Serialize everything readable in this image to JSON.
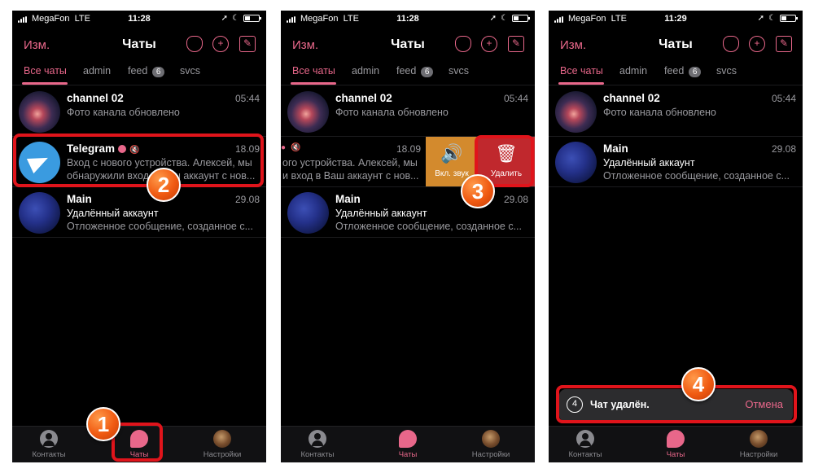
{
  "screens": [
    {
      "status": {
        "carrier": "MegaFon",
        "network": "LTE",
        "time": "11:28"
      },
      "header": {
        "edit": "Изм.",
        "title": "Чаты"
      },
      "tabs": [
        {
          "label": "Все чаты",
          "active": true
        },
        {
          "label": "admin"
        },
        {
          "label": "feed",
          "badge": "6"
        },
        {
          "label": "svcs"
        }
      ],
      "chats": [
        {
          "name": "channel 02",
          "time": "05:44",
          "line1": "Фото канала обновлено",
          "line2": ""
        },
        {
          "name": "Telegram",
          "time": "18.09",
          "line1": "Вход с нового устройства. Алексей, мы",
          "line2": "обнаружили вход в Ваш аккаунт с нов..."
        },
        {
          "name": "Main",
          "time": "29.08",
          "line1": "Удалённый аккаунт",
          "line2": "Отложенное сообщение, созданное с..."
        }
      ],
      "tabbar": [
        {
          "label": "Контакты",
          "icon": "person-icon"
        },
        {
          "label": "Чаты",
          "icon": "chats-icon",
          "active": true
        },
        {
          "label": "Настройки",
          "icon": "settings-avatar-icon"
        }
      ]
    },
    {
      "status": {
        "carrier": "MegaFon",
        "network": "LTE",
        "time": "11:28"
      },
      "header": {
        "edit": "Изм.",
        "title": "Чаты"
      },
      "tabs": [
        {
          "label": "Все чаты",
          "active": true
        },
        {
          "label": "admin"
        },
        {
          "label": "feed",
          "badge": "6"
        },
        {
          "label": "svcs"
        }
      ],
      "chats": [
        {
          "name": "channel 02",
          "time": "05:44",
          "line1": "Фото канала обновлено",
          "line2": ""
        },
        {
          "name": "",
          "time": "18.09",
          "line1": "ого устройства. Алексей, мы",
          "line2": "и вход в Ваш аккаунт с нов..."
        },
        {
          "name": "Main",
          "time": "29.08",
          "line1": "Удалённый аккаунт",
          "line2": "Отложенное сообщение, созданное с..."
        }
      ],
      "swipe_actions": [
        {
          "label": "Вкл. звук",
          "icon": "speaker-icon",
          "color": "#d38a2d"
        },
        {
          "label": "Удалить",
          "icon": "trash-icon",
          "color": "#c0282d"
        }
      ],
      "tabbar": [
        {
          "label": "Контакты",
          "icon": "person-icon"
        },
        {
          "label": "Чаты",
          "icon": "chats-icon",
          "active": true
        },
        {
          "label": "Настройки",
          "icon": "settings-avatar-icon"
        }
      ]
    },
    {
      "status": {
        "carrier": "MegaFon",
        "network": "LTE",
        "time": "11:29"
      },
      "header": {
        "edit": "Изм.",
        "title": "Чаты"
      },
      "tabs": [
        {
          "label": "Все чаты",
          "active": true
        },
        {
          "label": "admin"
        },
        {
          "label": "feed",
          "badge": "6"
        },
        {
          "label": "svcs"
        }
      ],
      "chats": [
        {
          "name": "channel 02",
          "time": "05:44",
          "line1": "Фото канала обновлено",
          "line2": ""
        },
        {
          "name": "Main",
          "time": "29.08",
          "line1": "Удалённый аккаунт",
          "line2": "Отложенное сообщение, созданное с..."
        }
      ],
      "toast": {
        "count": "4",
        "text": "Чат удалён.",
        "action": "Отмена"
      },
      "tabbar": [
        {
          "label": "Контакты",
          "icon": "person-icon"
        },
        {
          "label": "Чаты",
          "icon": "chats-icon",
          "active": true
        },
        {
          "label": "Настройки",
          "icon": "settings-avatar-icon"
        }
      ]
    }
  ],
  "markers": [
    "1",
    "2",
    "3",
    "4"
  ],
  "colors": {
    "accent": "#e8678a",
    "highlight": "#e0141b",
    "marker": "#f05a12"
  }
}
